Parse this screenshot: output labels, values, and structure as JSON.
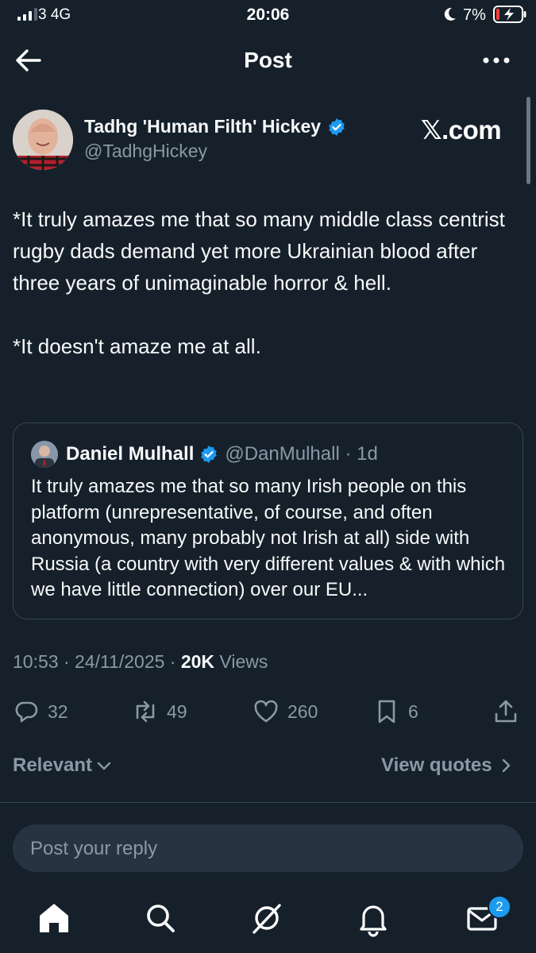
{
  "status_bar": {
    "carrier": "3  4G",
    "time": "20:06",
    "battery": "7%"
  },
  "header": {
    "title": "Post"
  },
  "tweet": {
    "author_name": "Tadhg 'Human Filth' Hickey",
    "author_handle": "@TadhgHickey",
    "watermark": "𝕏.com",
    "text": "*It truly amazes me that so many middle class centrist rugby dads demand yet more Ukrainian blood after three years of unimaginable horror & hell.\n\n*It doesn't amaze me at all.",
    "time": "10:53 · 24/11/2025 · ",
    "views_count": "20K",
    "views_label": " Views"
  },
  "quote": {
    "name": "Daniel Mulhall",
    "handle_time": "@DanMulhall · 1d",
    "text": "It truly amazes me that so many Irish people on this platform (unrepresentative, of course, and often anonymous, many probably not Irish at all) side with Russia (a country with very different values & with which we have little connection) over our EU..."
  },
  "actions": {
    "replies": "32",
    "reposts": "49",
    "likes": "260",
    "bookmarks": "6"
  },
  "sort": {
    "relevant_label": "Relevant",
    "view_quotes_label": "View quotes"
  },
  "reply": {
    "placeholder": "Post your reply"
  },
  "bottom_nav": {
    "messages_badge": "2",
    "icons": [
      "home-icon",
      "search-icon",
      "grok-icon",
      "bell-icon",
      "mail-icon"
    ]
  },
  "colors": {
    "background": "#15202b",
    "accent": "#1d9bf0",
    "secondary_text": "#8b98a5",
    "border": "#38444d"
  }
}
